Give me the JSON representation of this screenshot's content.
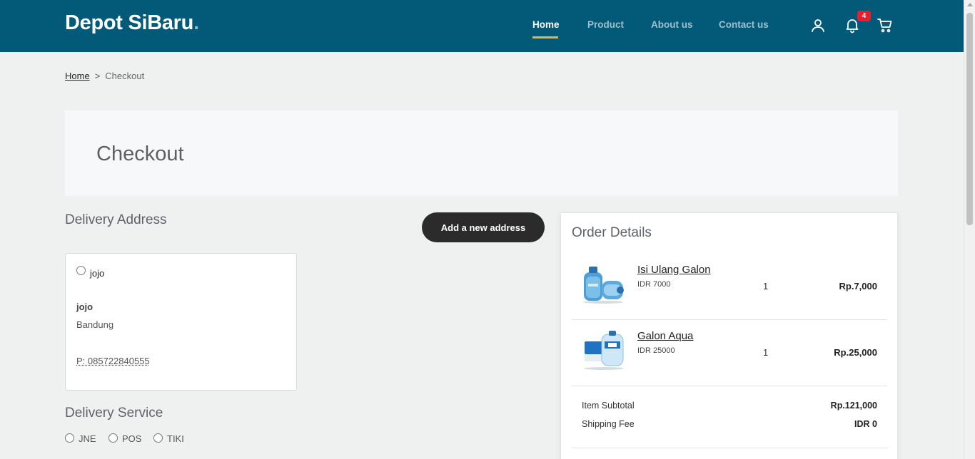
{
  "header": {
    "logo": "Depot SiBaru",
    "logo_dot": ".",
    "nav": {
      "home": "Home",
      "product": "Product",
      "about": "About us",
      "contact": "Contact us"
    },
    "notification_count": "4",
    "accent_color": "#035a78",
    "active_indicator_color": "#f4b41a"
  },
  "breadcrumb": {
    "home": "Home",
    "separator": ">",
    "current": "Checkout"
  },
  "page_title": "Checkout",
  "delivery_address": {
    "title": "Delivery Address",
    "add_button": "Add a new address",
    "address": {
      "label": "jojo",
      "name": "jojo",
      "city": "Bandung",
      "phone": "P: 085722840555"
    }
  },
  "delivery_service": {
    "title": "Delivery Service",
    "options": [
      "JNE",
      "POS",
      "TIKI"
    ]
  },
  "order_details": {
    "title": "Order Details",
    "items": [
      {
        "name": "Isi Ulang Galon",
        "price": "IDR 7000",
        "qty": "1",
        "total": "Rp.7,000"
      },
      {
        "name": "Galon Aqua",
        "price": "IDR 25000",
        "qty": "1",
        "total": "Rp.25,000"
      }
    ],
    "subtotal_label": "Item Subtotal",
    "subtotal_value": "Rp.121,000",
    "shipping_label": "Shipping Fee",
    "shipping_value": "IDR 0"
  }
}
